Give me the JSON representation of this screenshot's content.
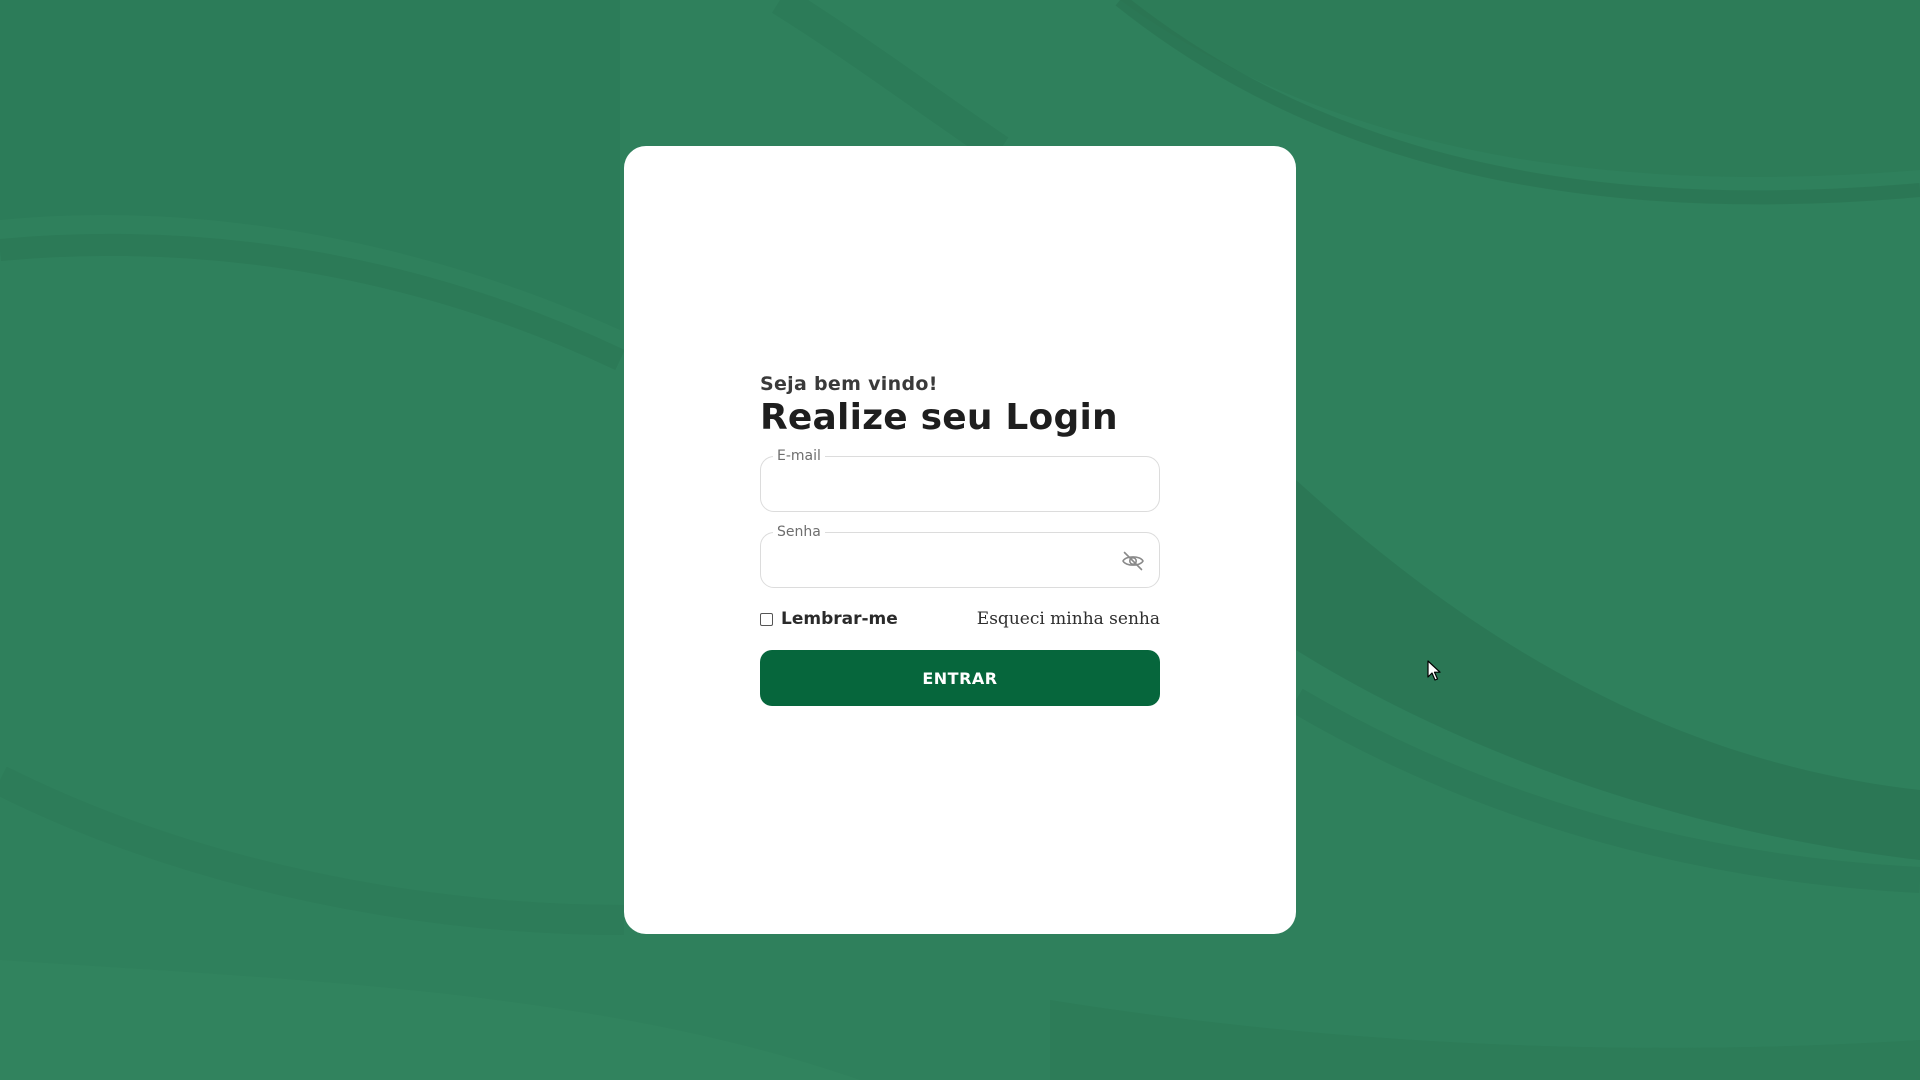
{
  "colors": {
    "background": "#2f805c",
    "background_wave_dark": "#2a7653",
    "background_wave_light": "#34875f",
    "card": "#ffffff",
    "primary_button": "#06663c",
    "field_border": "#dcdcdc"
  },
  "login": {
    "greeting": "Seja bem vindo!",
    "title": "Realize seu Login",
    "email": {
      "label": "E-mail",
      "value": "",
      "placeholder": ""
    },
    "password": {
      "label": "Senha",
      "value": "",
      "placeholder": "",
      "toggle_icon": "eye-off-icon"
    },
    "remember_label": "Lembrar-me",
    "remember_checked": false,
    "forgot_label": "Esqueci minha senha",
    "submit_label": "ENTRAR"
  },
  "pointer_icon": "mouse-pointer-icon"
}
